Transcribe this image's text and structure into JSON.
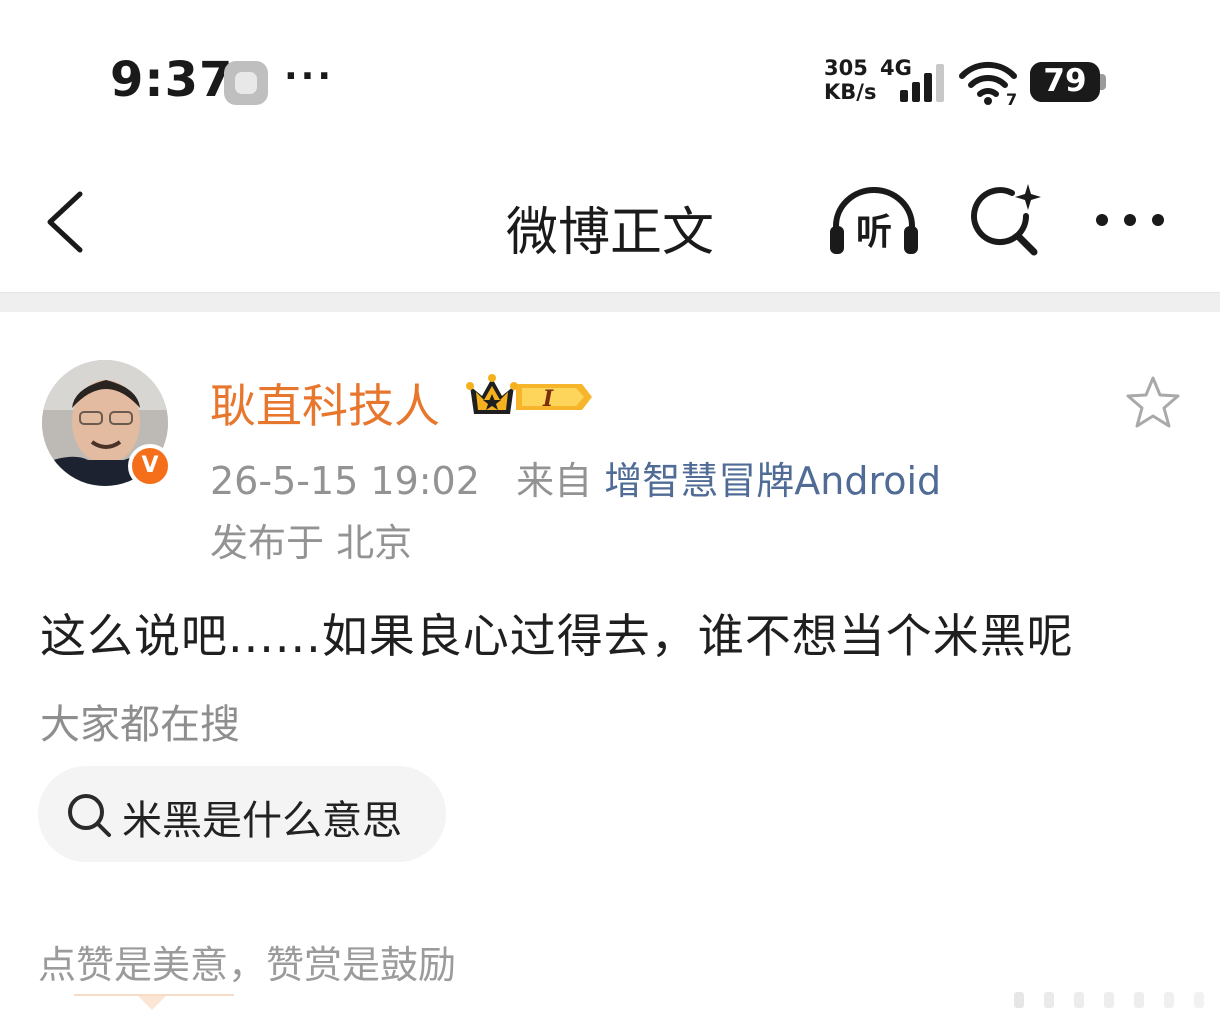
{
  "status_bar": {
    "time": "9:37",
    "dots": "···",
    "speed_value": "305",
    "speed_unit": "KB/s",
    "network_type": "4G",
    "wifi_level": "7",
    "battery": "79",
    "battery_level": 0.79
  },
  "nav": {
    "title": "微博正文",
    "listen_label": "听",
    "back_icon": "chevron-left-icon",
    "search_icon": "ai-search-icon",
    "more_icon": "more-dots-icon"
  },
  "post": {
    "author": "耿直科技人",
    "vip_level": "I",
    "verified_mark": "V",
    "date": "26-5-15 19:02",
    "from_label": "来自",
    "source": "增智慧冒牌Android",
    "location": "发布于 北京",
    "text": "这么说吧......如果良心过得去，谁不想当个米黑呢"
  },
  "search": {
    "heading": "大家都在搜",
    "chip": "米黑是什么意思"
  },
  "footer": {
    "reward": "点赞是美意，赞赏是鼓励"
  },
  "colors": {
    "username": "#e8772e",
    "source_link": "#4f6b96",
    "verify_badge": "#f56f1a",
    "meta_gray": "#939393"
  }
}
